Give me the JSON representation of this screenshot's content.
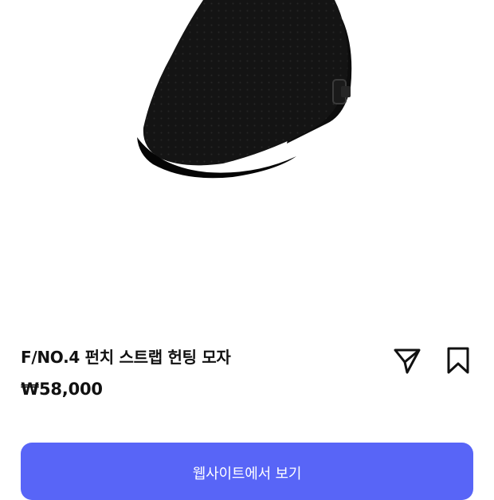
{
  "product": {
    "image_icon": "hunting-cap-photo",
    "title": "F/NO.4 펀치 스트랩 헌팅 모자",
    "price": "₩58,000"
  },
  "actions": {
    "share_icon": "send-icon",
    "bookmark_icon": "bookmark-icon"
  },
  "cta": {
    "label": "웹사이트에서 보기",
    "color": "#5865f7"
  }
}
